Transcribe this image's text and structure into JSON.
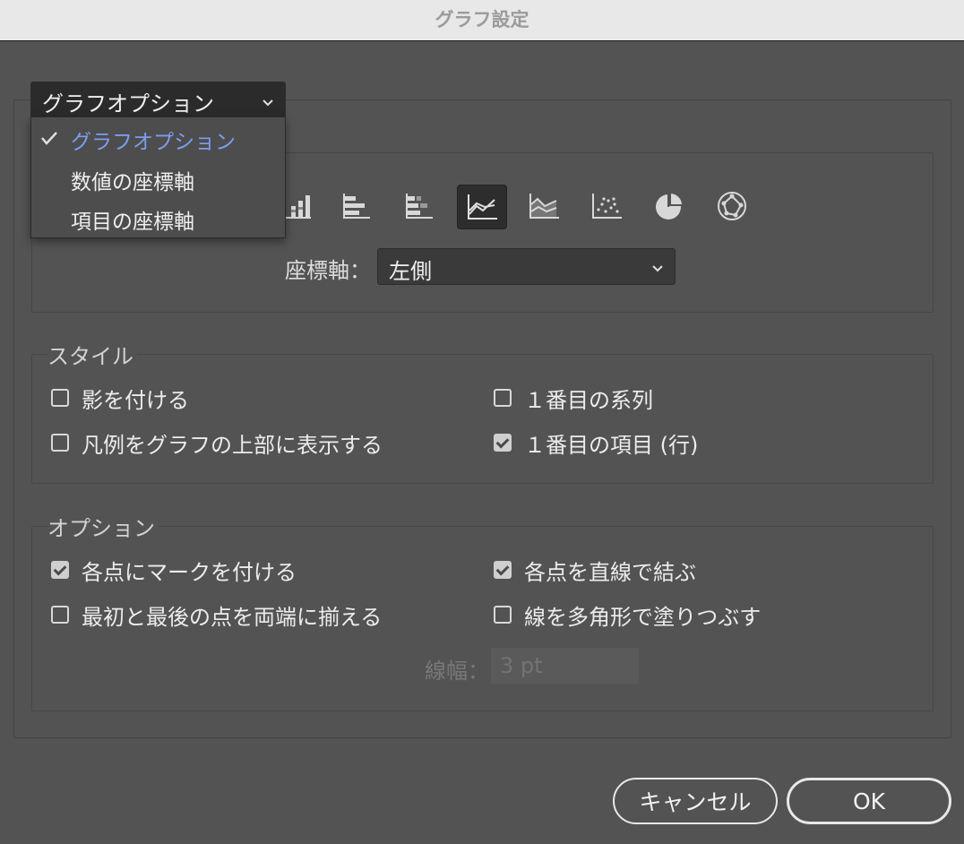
{
  "window": {
    "title": "グラフ設定"
  },
  "section_select": {
    "value": "グラフオプション",
    "options": [
      "グラフオプション",
      "数値の座標軸",
      "項目の座標軸"
    ]
  },
  "graph_types": [
    {
      "icon": "column-chart-icon"
    },
    {
      "icon": "stacked-column-chart-icon"
    },
    {
      "icon": "bar-chart-icon"
    },
    {
      "icon": "stacked-bar-chart-icon"
    },
    {
      "icon": "line-chart-icon",
      "selected": true
    },
    {
      "icon": "area-chart-icon"
    },
    {
      "icon": "scatter-chart-icon"
    },
    {
      "icon": "pie-chart-icon"
    },
    {
      "icon": "radar-chart-icon"
    }
  ],
  "axis": {
    "label": "座標軸：",
    "value": "左側"
  },
  "style": {
    "title": "スタイル",
    "shadow": {
      "label": "影を付ける",
      "checked": false
    },
    "legend_top": {
      "label": "凡例をグラフの上部に表示する",
      "checked": false
    },
    "first_series": {
      "label": "１番目の系列",
      "checked": false
    },
    "first_item": {
      "label": "１番目の項目 (行)",
      "checked": true
    }
  },
  "options": {
    "title": "オプション",
    "mark_points": {
      "label": "各点にマークを付ける",
      "checked": true
    },
    "edge_to_edge": {
      "label": "最初と最後の点を両端に揃える",
      "checked": false
    },
    "connect_lines": {
      "label": "各点を直線で結ぶ",
      "checked": true
    },
    "fill_lines": {
      "label": "線を多角形で塗りつぶす",
      "checked": false
    },
    "line_width": {
      "label": "線幅：",
      "value": "3 pt"
    }
  },
  "buttons": {
    "cancel": "キャンセル",
    "ok": "OK"
  },
  "colors": {
    "background": "#535353",
    "accent": "#7d9cf0"
  }
}
